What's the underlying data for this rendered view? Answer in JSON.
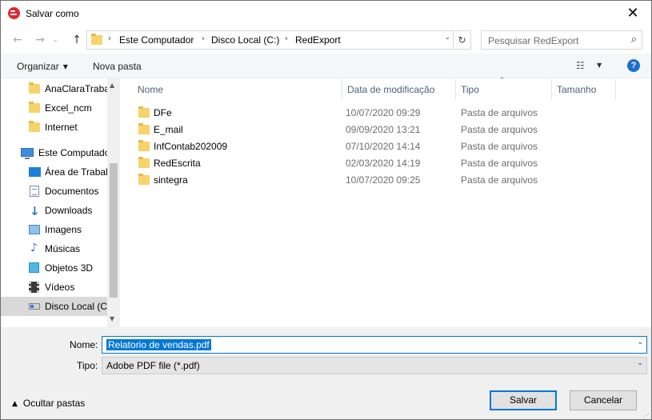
{
  "window": {
    "title": "Salvar como",
    "close": "✕"
  },
  "nav": {
    "back": "←",
    "forward": "→",
    "recent": "⌄",
    "up": "↑"
  },
  "address": {
    "separator": "›",
    "crumbs": [
      "Este Computador",
      "Disco Local (C:)",
      "RedExport"
    ],
    "dropdown": "⌄",
    "refresh": "↻"
  },
  "search": {
    "placeholder": "Pesquisar RedExport",
    "icon": "⌕"
  },
  "toolbar": {
    "organize": "Organizar",
    "new_folder": "Nova pasta",
    "caret": "▼",
    "view": "☷",
    "help": "?"
  },
  "sidebar": {
    "items": [
      {
        "label": "AnaClaraTraba",
        "icon": "folder-icon"
      },
      {
        "label": "Excel_ncm",
        "icon": "folder-icon"
      },
      {
        "label": "Internet",
        "icon": "folder-icon"
      },
      {
        "label": "Este Computador",
        "icon": "computer-icon"
      },
      {
        "label": "Área de Trabalh",
        "icon": "desktop-icon"
      },
      {
        "label": "Documentos",
        "icon": "documents-icon"
      },
      {
        "label": "Downloads",
        "icon": "download-icon",
        "glyph": "↓"
      },
      {
        "label": "Imagens",
        "icon": "images-icon"
      },
      {
        "label": "Músicas",
        "icon": "music-icon",
        "glyph": "♪"
      },
      {
        "label": "Objetos 3D",
        "icon": "objects-3d-icon"
      },
      {
        "label": "Vídeos",
        "icon": "videos-icon"
      },
      {
        "label": "Disco Local (C:",
        "icon": "drive-icon",
        "selected": true
      }
    ],
    "scroll_up": "▲",
    "scroll_down": "▼"
  },
  "filelist": {
    "columns": [
      "Nome",
      "Data de modificação",
      "Tipo",
      "Tamanho"
    ],
    "sort_caret": "^",
    "rows": [
      {
        "name": "DFe",
        "date": "10/07/2020 09:29",
        "type": "Pasta de arquivos"
      },
      {
        "name": "E_mail",
        "date": "09/09/2020 13:21",
        "type": "Pasta de arquivos"
      },
      {
        "name": "InfContab202009",
        "date": "07/10/2020 14:14",
        "type": "Pasta de arquivos"
      },
      {
        "name": "RedEscrita",
        "date": "02/03/2020 14:19",
        "type": "Pasta de arquivos"
      },
      {
        "name": "sintegra",
        "date": "10/07/2020 09:25",
        "type": "Pasta de arquivos"
      }
    ]
  },
  "form": {
    "name_label": "Nome:",
    "name_value": "Relatorio de vendas.pdf",
    "type_label": "Tipo:",
    "type_value": "Adobe PDF file (*.pdf)",
    "dropdown": "⌄"
  },
  "footer": {
    "hide_folders": "Ocultar pastas",
    "hide_chevron": "▲",
    "save": "Salvar",
    "cancel": "Cancelar",
    "grip": "⋰"
  },
  "colors": {
    "accent": "#0078d7",
    "folder": "#f6d36b",
    "brand": "#e3262f"
  }
}
